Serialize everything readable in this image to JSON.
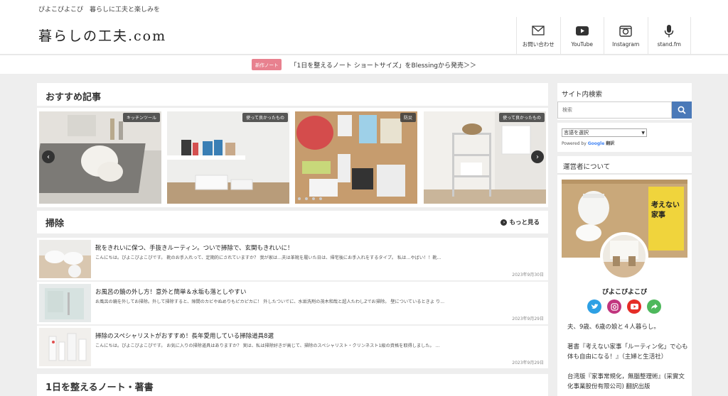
{
  "header": {
    "tagline": "ぴよこぴよこぴ　暮らしに工夫と楽しみを",
    "logo": "暮らしの工夫.com",
    "nav": [
      {
        "label": "お問い合わせ",
        "icon": "mail-icon"
      },
      {
        "label": "YouTube",
        "icon": "youtube-icon"
      },
      {
        "label": "Instagram",
        "icon": "instagram-icon"
      },
      {
        "label": "stand.fm",
        "icon": "microphone-icon"
      }
    ]
  },
  "notice": {
    "badge": "新作ノート",
    "text": "「1日を整えるノート ショートサイズ」をBlessingから発売＞＞"
  },
  "recommended": {
    "title": "おすすめ記事",
    "slides": [
      {
        "tag": "キッチンツール"
      },
      {
        "tag": "使って良かったもの"
      },
      {
        "tag": "防災"
      },
      {
        "tag": "使って良かったもの"
      }
    ]
  },
  "cleaning": {
    "title": "掃除",
    "more": "もっと見る",
    "articles": [
      {
        "title": "靴をきれいに保つ、手抜きルーティン。ついで掃除で、玄関もきれいに！",
        "excerpt": "こんにちは。ぴよこぴよこぴです。 靴のお手入れって、定期的にされていますか？ 我が家は…夫は革靴を履いた日は、帰宅後にお手入れをするタイプ。 私は…やばい！！靴...",
        "date": "2023年9月30日"
      },
      {
        "title": "お風呂の鏡の外し方！意外と簡単＆水垢も落としやすい",
        "excerpt": "お風呂の鏡を外してお掃除。外して掃除すると、隙間のカビやぬめりもピカピカに！ 外したついでに、水垢洗剤の茂木和哉と超人たわしZでお掃除。 壁についているときよ り...",
        "date": "2023年9月29日"
      },
      {
        "title": "掃除のスペシャリストがおすすめ！長年愛用している掃除道具8選",
        "excerpt": "こんにちは。ぴよこぴよこぴです。 お気に入りの掃除道具はありますか？ 実は、私は掃除好きが高じて、掃除のスペシャリスト・クリンネスト1級の資格を取得しました。 ...",
        "date": "2023年9月29日"
      }
    ]
  },
  "notebook": {
    "title": "1日を整えるノート・著書"
  },
  "sidebar": {
    "search": {
      "title": "サイト内検索",
      "placeholder": "検索"
    },
    "translate": {
      "select": "言語を選択",
      "powered_prefix": "Powered by",
      "google": "Google",
      "translate_label": "翻訳"
    },
    "about": {
      "title": "運営者について",
      "name": "ぴよこぴよこぴ",
      "book_title": "考えない家事",
      "bio1": "夫、9歳、6歳の娘と４人暮らし。",
      "bio2": "著書『考えない家事「ルーティン化」で心も体も自由になる！』（主婦と生活社）",
      "bio3": "台湾版『家事常規化，無腦整理術』(采實文化事業股份有限公司) 翻訳出版",
      "socials": [
        {
          "icon": "twitter-icon",
          "color": "#2da0e4"
        },
        {
          "icon": "instagram-icon",
          "color": "#c1357e"
        },
        {
          "icon": "youtube-icon",
          "color": "#e52d27"
        },
        {
          "icon": "share-icon",
          "color": "#4eb85c"
        }
      ]
    }
  }
}
